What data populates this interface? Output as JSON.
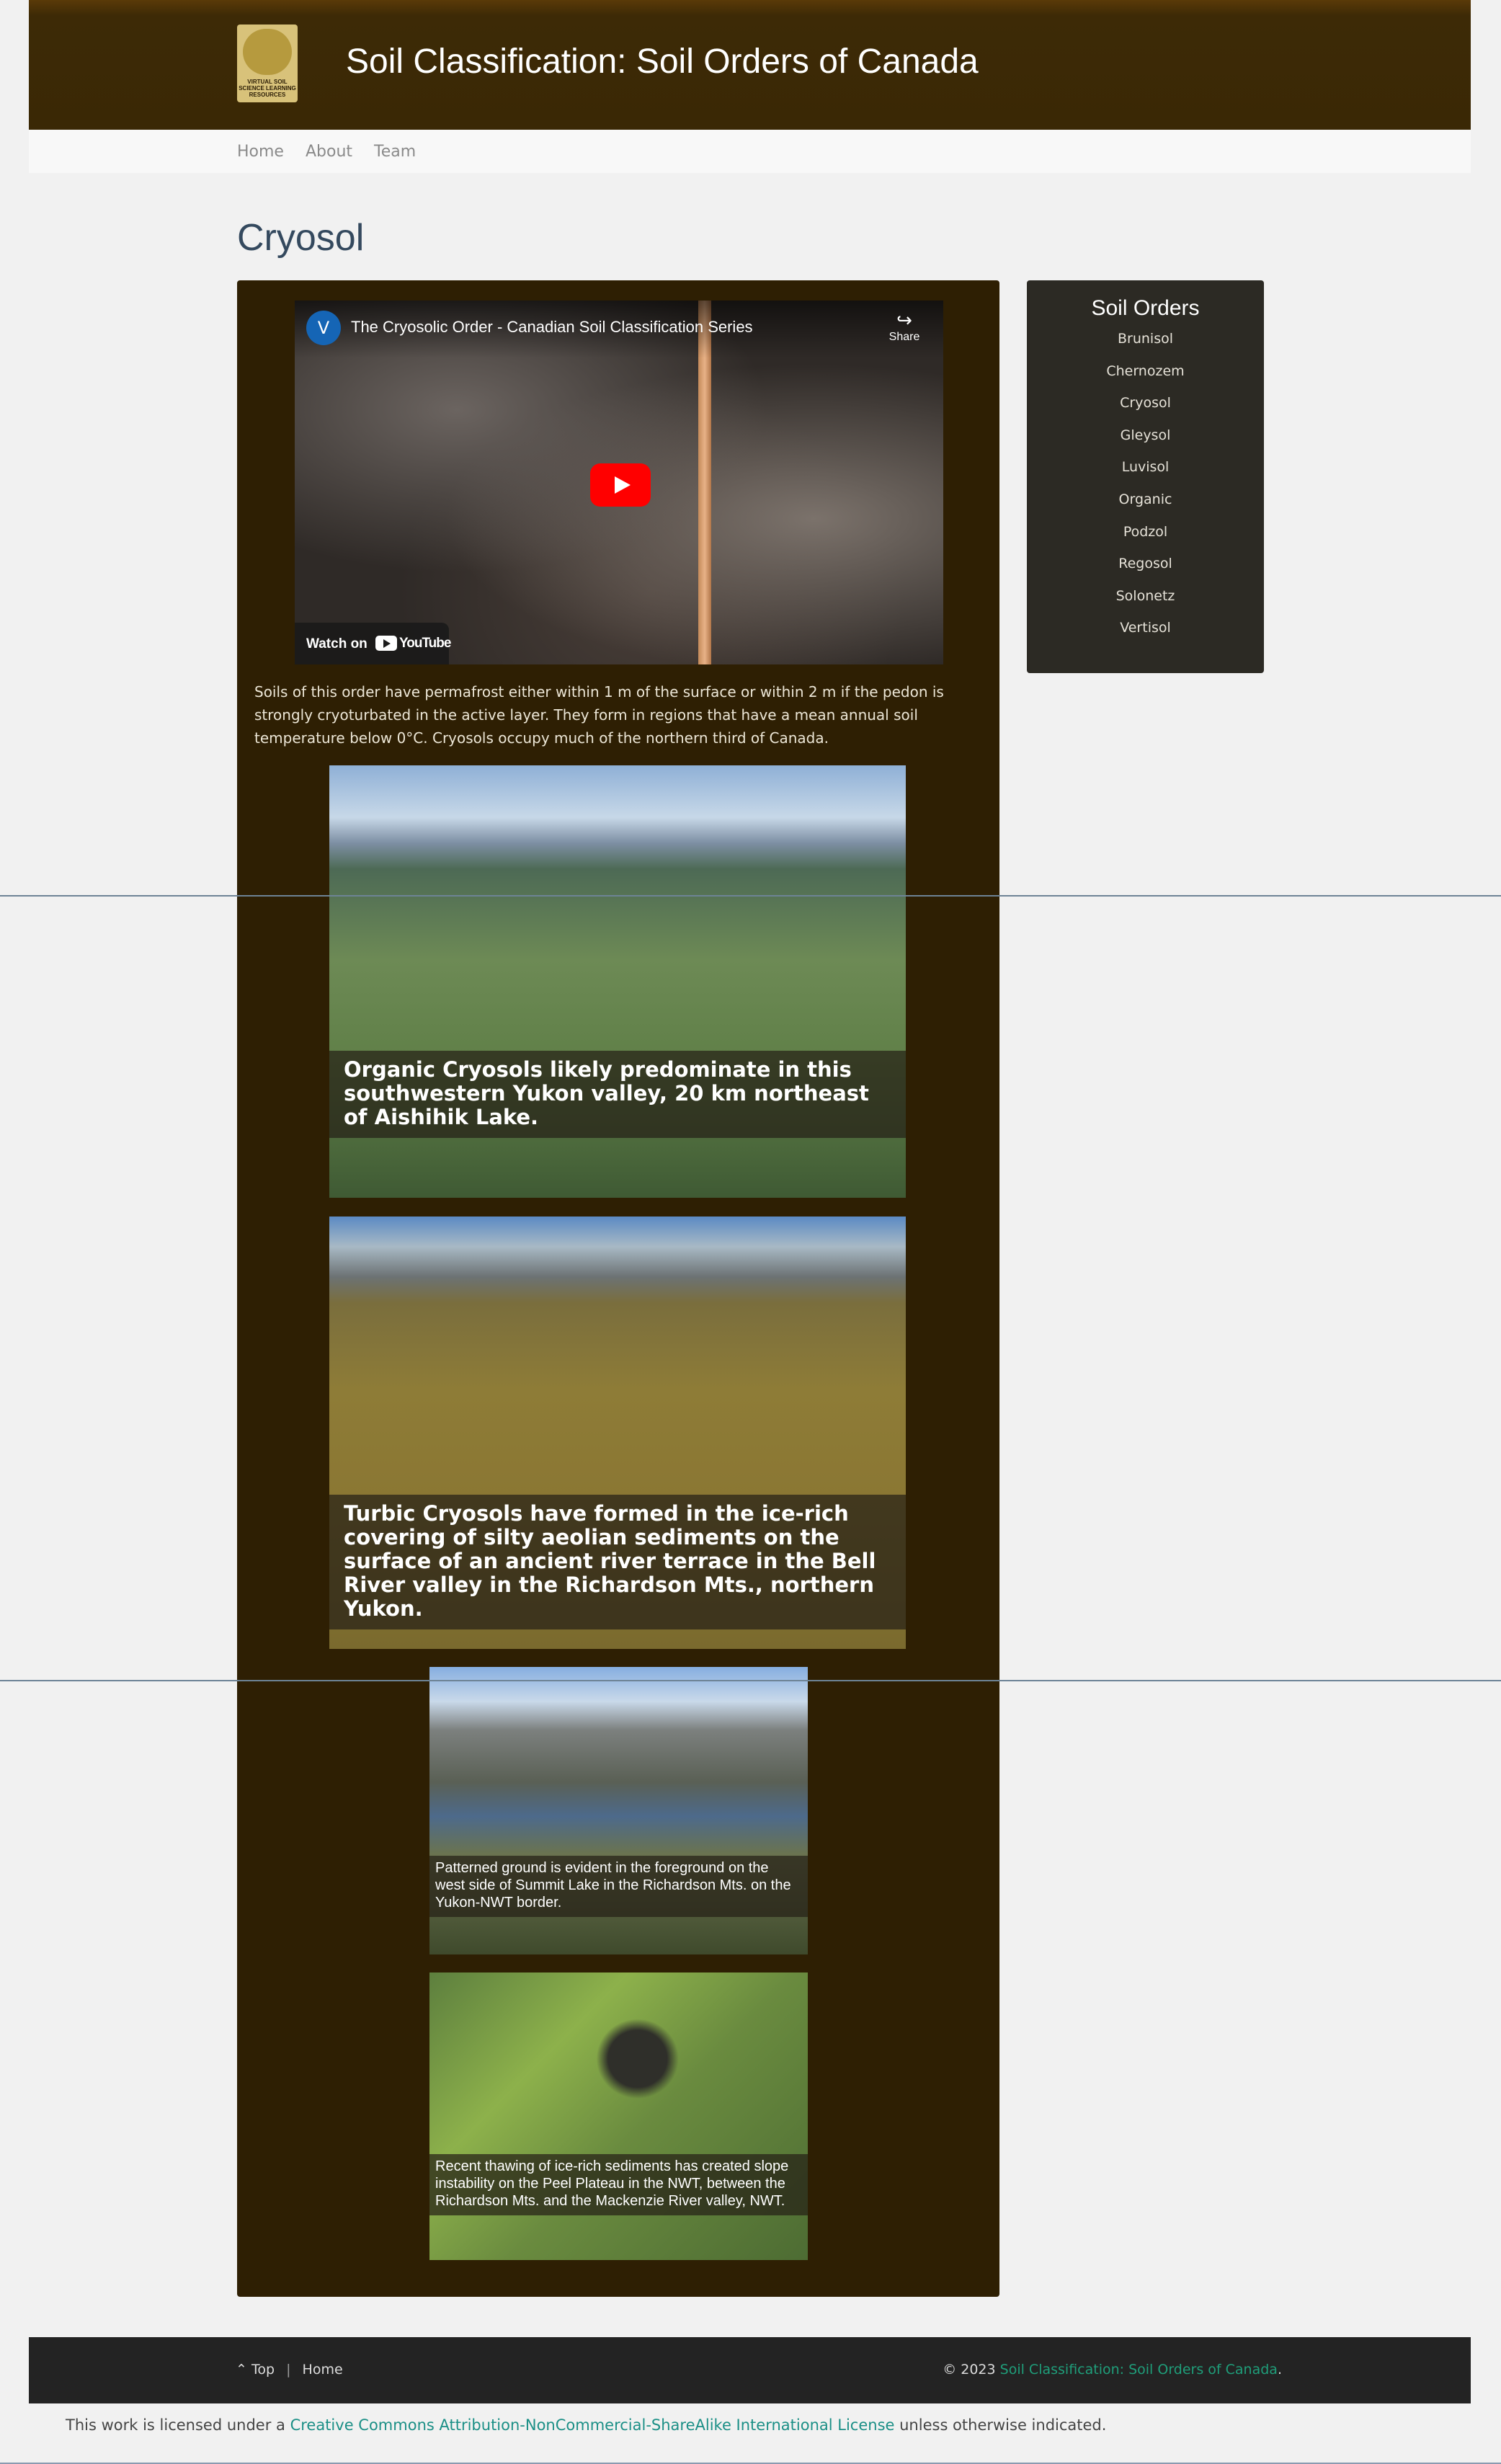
{
  "header": {
    "logo_text": "VIRTUAL SOIL SCIENCE LEARNING RESOURCES",
    "site_title": "Soil Classification: Soil Orders of Canada"
  },
  "nav": {
    "items": [
      {
        "label": "Home"
      },
      {
        "label": "About"
      },
      {
        "label": "Team"
      }
    ]
  },
  "page": {
    "title": "Cryosol"
  },
  "video": {
    "channel_initial": "V",
    "title": "The Cryosolic Order - Canadian Soil Classification Series",
    "share_label": "Share",
    "watch_label": "Watch on",
    "youtube_label": "YouTube"
  },
  "intro": "Soils of this order have permafrost either within 1 m of the surface or within 2 m if the pedon is strongly cryoturbated in the active layer.  They form in regions that have a mean annual soil temperature below 0°C.  Cryosols occupy much of the northern third of Canada.",
  "figures": [
    {
      "caption": "Organic Cryosols likely predominate in this southwestern Yukon valley, 20 km northeast of Aishihik Lake."
    },
    {
      "caption": "Turbic Cryosols have formed in the ice-rich covering of silty aeolian sediments on the surface of an ancient river terrace in the Bell River valley in the Richardson Mts., northern Yukon."
    },
    {
      "caption": "Patterned ground is evident in the foreground on the west side of Summit Lake in the Richardson Mts. on the Yukon-NWT border."
    },
    {
      "caption": "Recent thawing of ice-rich sediments has created slope instability on the Peel Plateau in the NWT, between the Richardson Mts. and the Mackenzie River valley, NWT."
    }
  ],
  "sidebar": {
    "title": "Soil Orders",
    "items": [
      {
        "label": "Brunisol"
      },
      {
        "label": "Chernozem"
      },
      {
        "label": "Cryosol"
      },
      {
        "label": "Gleysol"
      },
      {
        "label": "Luvisol"
      },
      {
        "label": "Organic"
      },
      {
        "label": "Podzol"
      },
      {
        "label": "Regosol"
      },
      {
        "label": "Solonetz"
      },
      {
        "label": "Vertisol"
      }
    ]
  },
  "footer": {
    "top_icon": "chevron-up-icon",
    "top_label": "Top",
    "separator": "|",
    "home_label": "Home",
    "copyright": "© 2023",
    "site_link": "Soil Classification: Soil Orders of Canada",
    "period": "."
  },
  "license": {
    "prefix": "This work is licensed under a",
    "link": "Creative Commons Attribution-NonCommercial-ShareAlike International License",
    "suffix": "unless otherwise indicated."
  },
  "colors": {
    "header_bg": "#3d2a06",
    "content_bg": "#2e1f03",
    "sidebar_bg": "#2c2a24",
    "title_color": "#34495e",
    "accent_link": "#1f9e7a",
    "youtube_red": "#ff0000"
  }
}
